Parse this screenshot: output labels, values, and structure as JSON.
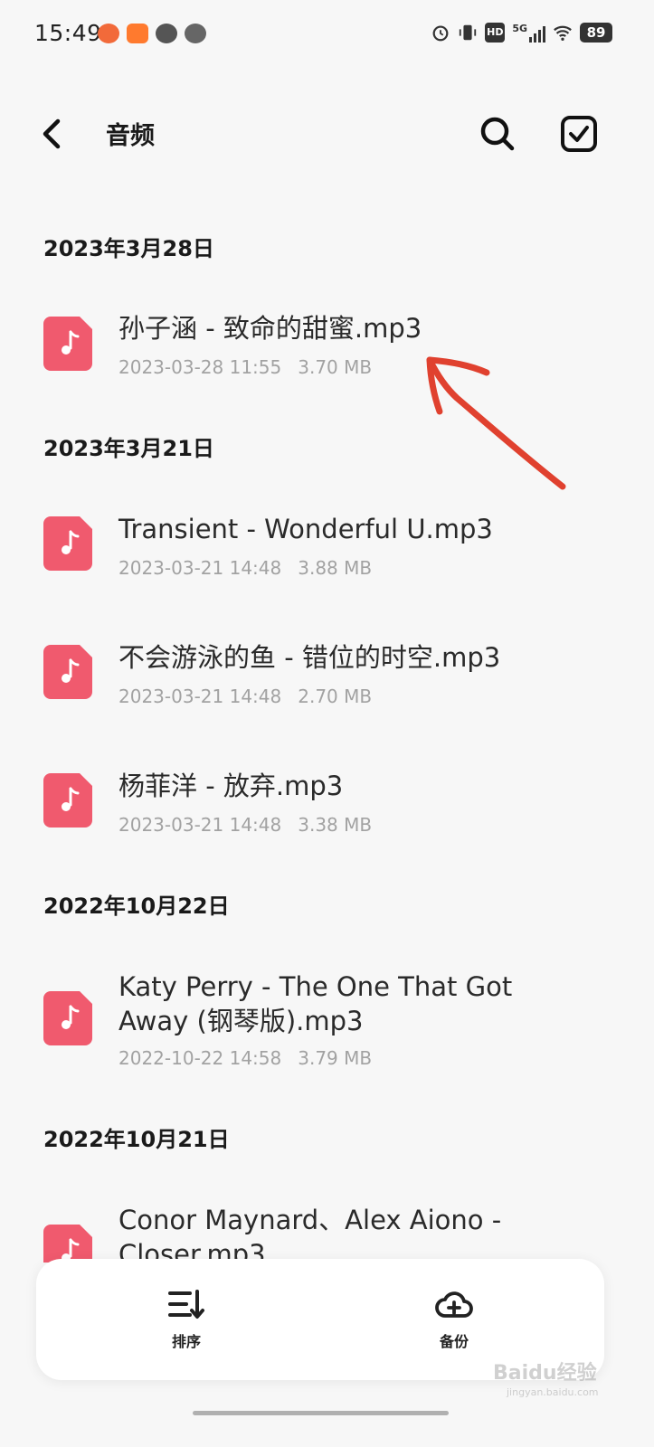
{
  "status_bar": {
    "time": "15:49",
    "battery": "89",
    "network": "5G",
    "hd": "HD",
    "icons": [
      "alarm-icon",
      "vibrate-icon",
      "hd-icon",
      "5g-signal-icon",
      "wifi-icon",
      "battery-icon"
    ],
    "app_icons": [
      "app-notification-icon-1",
      "app-notification-icon-2",
      "message-bubble-icon",
      "app-notification-icon-3"
    ]
  },
  "header": {
    "title": "音频",
    "back_icon": "back-chevron-icon",
    "search_icon": "search-icon",
    "select_icon": "select-checkbox-icon"
  },
  "groups": [
    {
      "date": "2023年3月28日",
      "files": [
        {
          "name": "孙子涵 - 致命的甜蜜.mp3",
          "date": "2023-03-28 11:55",
          "size": "3.70 MB"
        }
      ]
    },
    {
      "date": "2023年3月21日",
      "files": [
        {
          "name": "Transient - Wonderful U.mp3",
          "date": "2023-03-21 14:48",
          "size": "3.88 MB"
        },
        {
          "name": "不会游泳的鱼 - 错位的时空.mp3",
          "date": "2023-03-21 14:48",
          "size": "2.70 MB"
        },
        {
          "name": "杨菲洋 - 放弃.mp3",
          "date": "2023-03-21 14:48",
          "size": "3.38 MB"
        }
      ]
    },
    {
      "date": "2022年10月22日",
      "files": [
        {
          "name": "Katy Perry - The One That Got Away (钢琴版).mp3",
          "date": "2022-10-22 14:58",
          "size": "3.79 MB"
        }
      ]
    },
    {
      "date": "2022年10月21日",
      "files": [
        {
          "name": "Conor Maynard、Alex Aiono - Closer.mp3",
          "date": "",
          "size": ""
        }
      ]
    }
  ],
  "bottom_bar": {
    "sort_label": "排序",
    "backup_label": "备份",
    "sort_icon": "sort-icon",
    "backup_icon": "cloud-add-icon"
  },
  "watermark": {
    "text": "Baidu经验",
    "sub": "jingyan.baidu.com"
  },
  "colors": {
    "accent_file": "#f05a6e",
    "annotation_arrow": "#e0412f",
    "background": "#f7f7f7"
  }
}
